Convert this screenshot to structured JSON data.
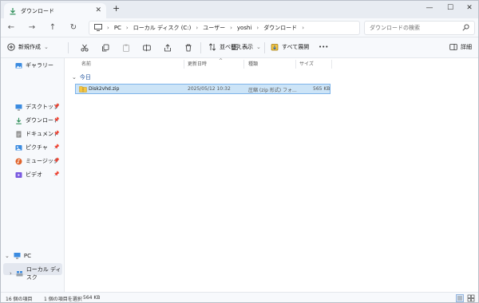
{
  "tab": {
    "title": "ダウンロード",
    "close": "✕",
    "new": "+"
  },
  "window_controls": {
    "minimize": "—",
    "maximize": "☐",
    "close": "✕"
  },
  "address": {
    "crumbs": [
      "PC",
      "ローカル ディスク (C:)",
      "ユーザー",
      "yoshi",
      "ダウンロード"
    ],
    "separator": "›"
  },
  "search": {
    "placeholder": "ダウンロードの検索"
  },
  "commands": {
    "new": "新規作成",
    "sort": "並べ替え",
    "view": "表示",
    "select_all": "すべて展開",
    "more": "•••",
    "details": "詳細"
  },
  "sidebar": {
    "gallery": "ギャラリー",
    "items": [
      {
        "label": "デスクトップ",
        "icon": "desktop-icon",
        "color": "#3b8be0"
      },
      {
        "label": "ダウンロード",
        "icon": "download-icon",
        "color": "#2f8f5a"
      },
      {
        "label": "ドキュメント",
        "icon": "document-icon",
        "color": "#7a7a7a"
      },
      {
        "label": "ピクチャ",
        "icon": "picture-icon",
        "color": "#3b8be0"
      },
      {
        "label": "ミュージック",
        "icon": "music-icon",
        "color": "#e0632b"
      },
      {
        "label": "ビデオ",
        "icon": "video-icon",
        "color": "#7a5ae0"
      }
    ],
    "pc": "PC",
    "local_disk": "ローカル ディスク"
  },
  "columns": {
    "name": "名前",
    "date": "更新日時",
    "type": "種類",
    "size": "サイズ"
  },
  "group": {
    "label": "今日",
    "chevron": "⌄"
  },
  "file": {
    "name": "Disk2vhd.zip",
    "date": "2025/05/12 10:32",
    "type": "圧縮 (zip 形式) フォ...",
    "size": "565 KB"
  },
  "status": {
    "count": "16 個の項目",
    "selected": "1 個の項目を選択",
    "selected_size": "564 KB"
  },
  "colors": {
    "accent": "#0067c0",
    "selection": "#cce4f7",
    "selection_border": "#7eb4ea"
  }
}
